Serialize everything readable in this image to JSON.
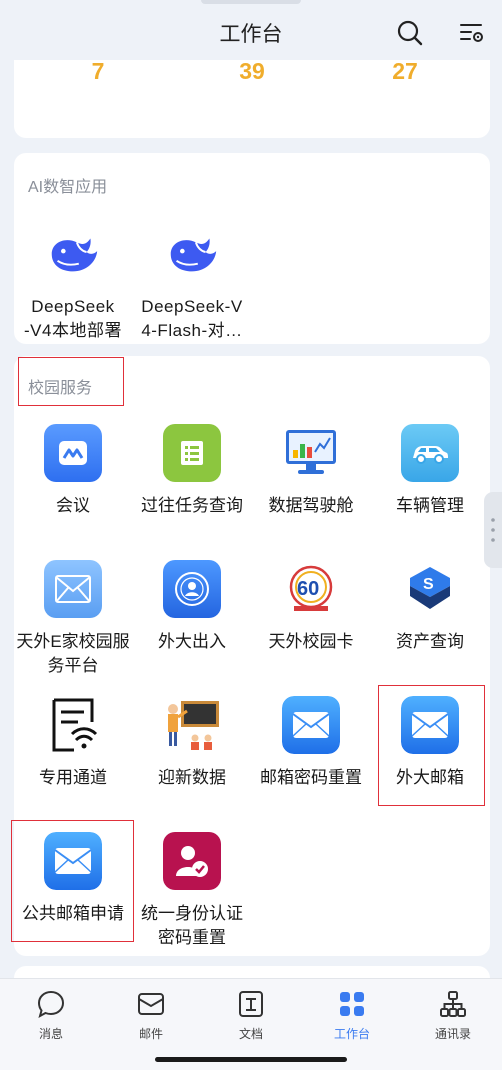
{
  "header": {
    "title": "工作台",
    "search_icon": "search-icon",
    "settings_icon": "list-settings-icon"
  },
  "stats": {
    "values": [
      "7",
      "39",
      "27"
    ],
    "color": "#f0ad2c"
  },
  "ai_section": {
    "title": "AI数智应用",
    "apps": [
      {
        "line1": "DeepSeek",
        "line2": "-V4本地部署",
        "icon": "deepseek-whale-icon"
      },
      {
        "line1": "DeepSeek-V",
        "line2": "4-Flash-对…",
        "icon": "deepseek-whale-icon"
      }
    ]
  },
  "campus_section": {
    "title": "校园服务",
    "apps": [
      {
        "label": "会议",
        "icon": "meeting-icon"
      },
      {
        "label": "过往任务查询",
        "icon": "task-list-icon"
      },
      {
        "label": "数据驾驶舱",
        "icon": "dashboard-icon"
      },
      {
        "label": "车辆管理",
        "icon": "car-icon"
      },
      {
        "line1": "天外E家校园服",
        "line2": "务平台",
        "icon": "mail-icon"
      },
      {
        "label": "外大出入",
        "icon": "access-badge-icon"
      },
      {
        "label": "天外校园卡",
        "icon": "campus-card-logo-icon"
      },
      {
        "label": "资产查询",
        "icon": "asset-icon"
      },
      {
        "label": "专用通道",
        "icon": "wifi-doc-icon"
      },
      {
        "label": "迎新数据",
        "icon": "presentation-icon"
      },
      {
        "label": "邮箱密码重置",
        "icon": "mail-icon"
      },
      {
        "label": "外大邮箱",
        "icon": "mail-icon"
      },
      {
        "label": "公共邮箱申请",
        "icon": "mail-icon"
      },
      {
        "line1": "统一身份认证",
        "line2": "密码重置",
        "icon": "user-verify-icon"
      }
    ]
  },
  "tabbar": {
    "tabs": [
      {
        "label": "消息",
        "icon": "chat-bubble-icon",
        "active": false
      },
      {
        "label": "邮件",
        "icon": "envelope-icon",
        "active": false
      },
      {
        "label": "文档",
        "icon": "document-icon",
        "active": false
      },
      {
        "label": "工作台",
        "icon": "grid-icon",
        "active": true
      },
      {
        "label": "通讯录",
        "icon": "org-chart-icon",
        "active": false
      }
    ],
    "active_color": "#3a7bf0"
  },
  "colors": {
    "highlight": "#e0303a",
    "background": "#eef2f8"
  }
}
